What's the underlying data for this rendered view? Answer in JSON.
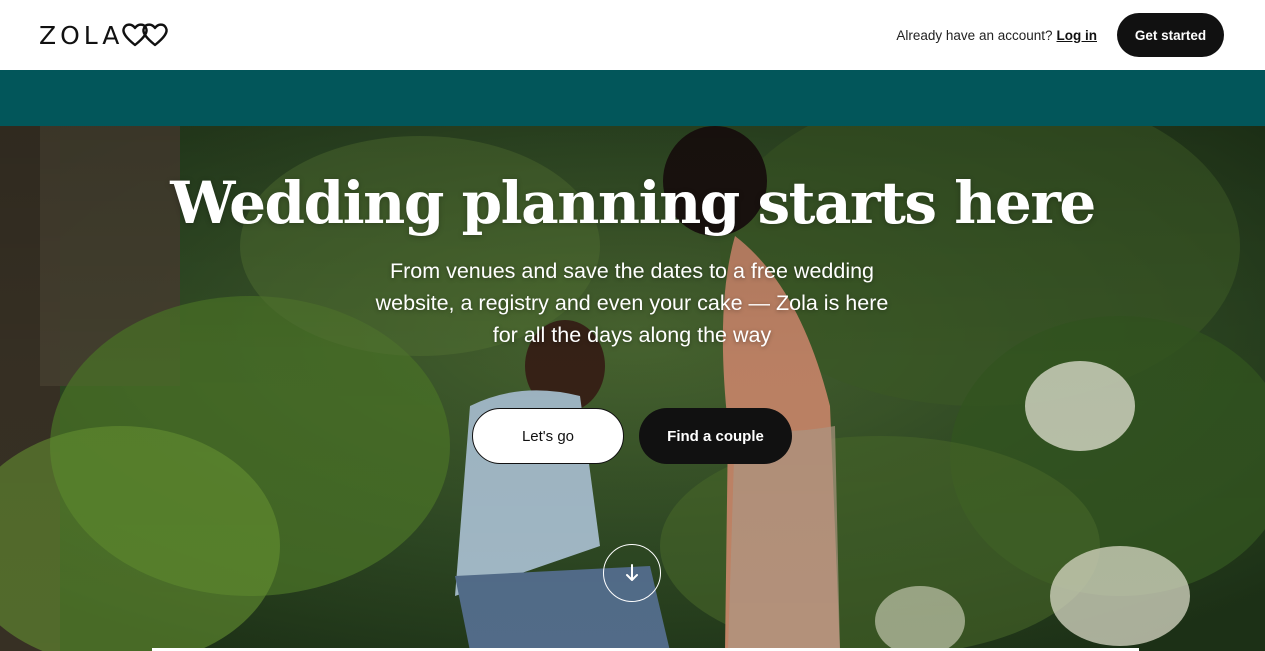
{
  "header": {
    "logo_text": "ZOLA",
    "logo_icon": "double-heart-logo",
    "account_prompt": "Already have an account?",
    "login_label": "Log in",
    "get_started_label": "Get started"
  },
  "banner": {
    "color": "#02565a"
  },
  "hero": {
    "title": "Wedding planning starts here",
    "subtitle": "From venues and save the dates to a free wedding website, a registry and even your cake — Zola is here for all the days along the way",
    "primary_button": "Let's go",
    "secondary_button": "Find a couple",
    "scroll_icon": "arrow-down-icon"
  },
  "colors": {
    "brand_teal": "#02565a",
    "button_dark": "#111111",
    "text_light": "#ffffff"
  }
}
